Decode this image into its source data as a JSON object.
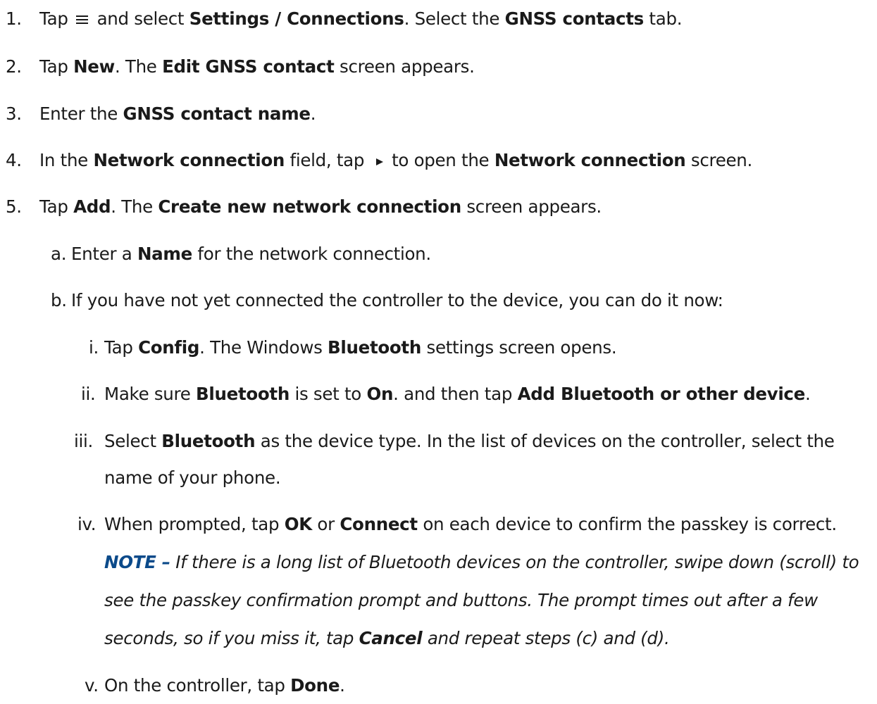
{
  "steps": {
    "s1": {
      "num": "1.",
      "t1": "Tap ",
      "menu_icon": "menu-icon",
      "t2": " and select ",
      "b1": "Settings / Connections",
      "t3": ". Select the ",
      "b2": "GNSS contacts",
      "t4": " tab."
    },
    "s2": {
      "num": "2.",
      "t1": "Tap ",
      "b1": "New",
      "t2": ". The ",
      "b2": "Edit GNSS contact",
      "t3": " screen appears."
    },
    "s3": {
      "num": "3.",
      "t1": "Enter the ",
      "b1": "GNSS contact name",
      "t2": "."
    },
    "s4": {
      "num": "4.",
      "t1": "In the ",
      "b1": "Network connection",
      "t2": " field, tap ",
      "arrow_icon": "play-arrow-icon",
      "t3": " to open the ",
      "b2": "Network connection",
      "t4": " screen."
    },
    "s5": {
      "num": "5.",
      "t1": "Tap ",
      "b1": "Add",
      "t2": ". The ",
      "b2": "Create new network connection",
      "t3": " screen appears."
    },
    "s5a": {
      "num": "a.",
      "t1": "Enter a ",
      "b1": "Name",
      "t2": " for the network connection."
    },
    "s5b": {
      "num": "b.",
      "t1": "If you have not yet connected the controller to the device, you can do it now:"
    },
    "s5bi": {
      "num": "i.",
      "t1": "Tap ",
      "b1": "Config",
      "t2": ". The Windows ",
      "b2": "Bluetooth",
      "t3": " settings screen opens."
    },
    "s5bii": {
      "num": "ii.",
      "t1": "Make sure ",
      "b1": "Bluetooth",
      "t2": " is set to ",
      "b2": "On",
      "t3": ". and then tap ",
      "b3": "Add Bluetooth or other device",
      "t4": "."
    },
    "s5biii": {
      "num": "iii.",
      "t1": "Select ",
      "b1": "Bluetooth",
      "t2": " as the device type. In the list of devices on the controller, select the",
      "t3": "name of your phone."
    },
    "s5biv": {
      "num": "iv.",
      "t1": "When prompted, tap ",
      "b1": "OK",
      "t2": " or ",
      "b2": "Connect",
      "t3": " on each device to confirm the passkey is correct."
    },
    "note": {
      "label": "NOTE –",
      "t1": " If there is a long list of Bluetooth devices on the controller, swipe down (scroll) to",
      "t2": "see the passkey confirmation prompt and buttons. The prompt times out after a few",
      "t3": "seconds, so if you miss it, tap ",
      "b1": "Cancel",
      "t4": " and repeat steps (c) and (d)."
    },
    "s5bv": {
      "num": "v.",
      "t1": "On the controller, tap ",
      "b1": "Done",
      "t2": "."
    }
  },
  "colors": {
    "text": "#1a1a1a",
    "note_label": "#0b4a8a"
  }
}
